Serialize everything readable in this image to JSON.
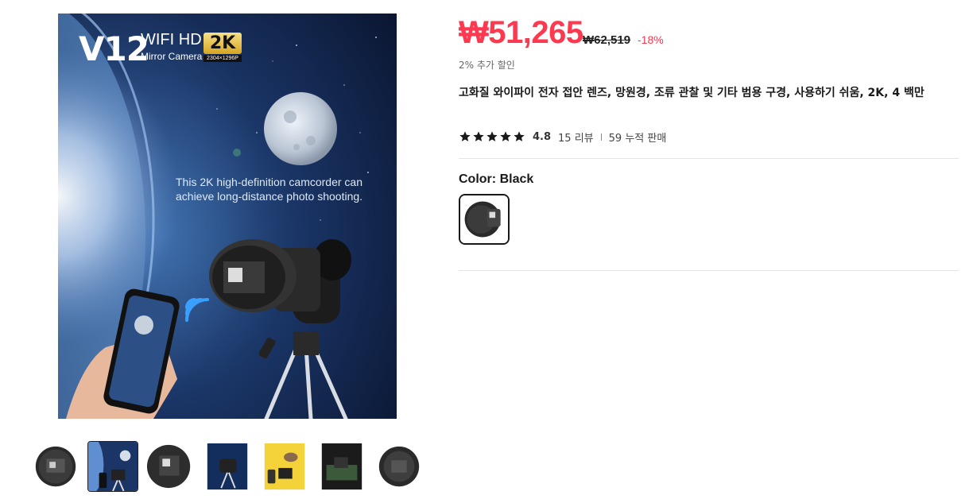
{
  "product_image": {
    "brand": "V12",
    "headline": "WIFI HD",
    "subline": "Mirror Camera",
    "badge": "2K",
    "resolution": "2304×1296P",
    "tagline": "This 2K high-definition camcorder can achieve long-distance photo shooting."
  },
  "thumbnails": [
    {
      "name": "thumb-camera-front"
    },
    {
      "name": "thumb-night-sky",
      "active": true
    },
    {
      "name": "thumb-camera-side"
    },
    {
      "name": "thumb-tripod-blue"
    },
    {
      "name": "thumb-bird-yellow"
    },
    {
      "name": "thumb-night-scene"
    },
    {
      "name": "thumb-camera-back"
    }
  ],
  "price": {
    "current": "₩51,265",
    "original": "₩62,519",
    "discount": "-18%",
    "extra": "2% 추가 할인"
  },
  "title": "고화질 와이파이 전자 접안 렌즈, 망원경, 조류 관찰 및 기타 범용 구경, 사용하기 쉬움, 2K, 4 백만",
  "rating": {
    "stars": 5,
    "value": "4.8",
    "reviews": "15 리뷰",
    "sold": "59 누적 판매"
  },
  "color": {
    "label": "Color",
    "selected": "Black"
  },
  "colors": {
    "accent": "#fd384f",
    "text": "#191919"
  }
}
